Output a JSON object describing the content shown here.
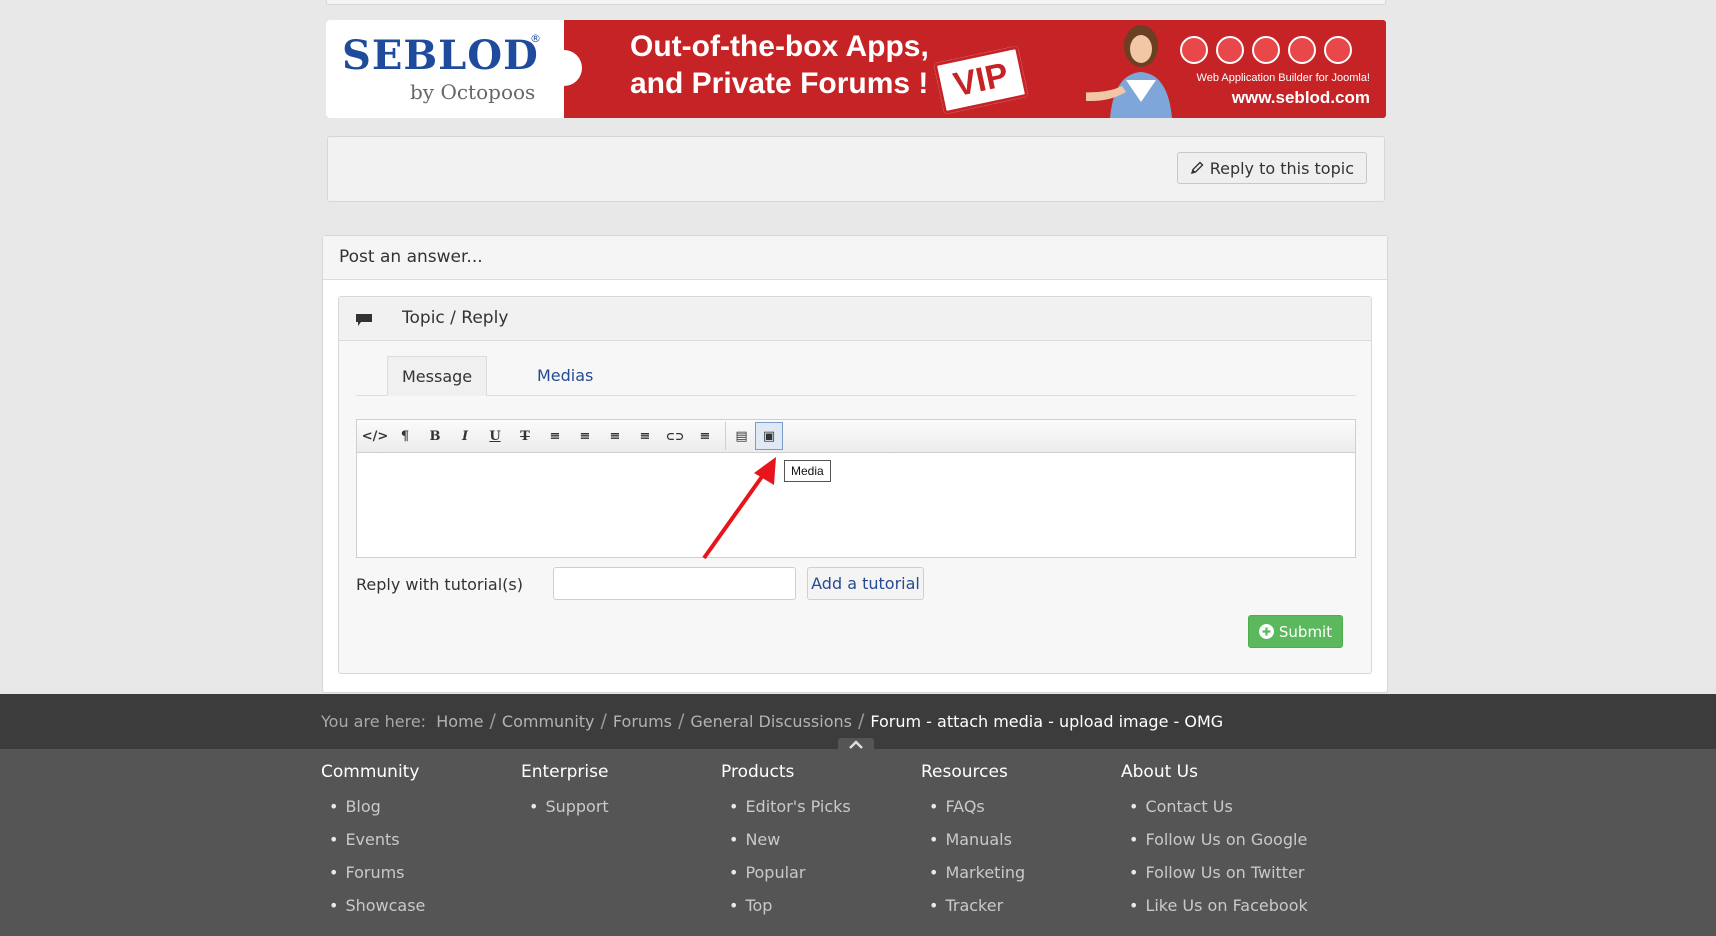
{
  "banner": {
    "logo": "SEBLOD",
    "logo_sub": "by Octopoos",
    "headline_line1": "Out-of-the-box Apps,",
    "headline_line2": "and Private Forums !",
    "badge": "VIP",
    "tagline": "Web Application Builder for Joomla!",
    "url": "www.seblod.com",
    "colors": {
      "red": "#c62326",
      "blue": "#1e4b9c"
    }
  },
  "reply_panel": {
    "reply_button": "Reply to this topic",
    "icon": "pencil-icon"
  },
  "answer": {
    "heading": "Post an answer...",
    "section_title": "Topic / Reply",
    "section_icon": "chat-bubble-icon",
    "tabs": [
      {
        "label": "Message",
        "active": true
      },
      {
        "label": "Medias",
        "active": false
      }
    ],
    "toolbar": [
      {
        "name": "code-icon",
        "glyph": "</>"
      },
      {
        "name": "paragraph-icon",
        "glyph": "¶"
      },
      {
        "name": "bold-icon",
        "glyph": "B"
      },
      {
        "name": "italic-icon",
        "glyph": "I"
      },
      {
        "name": "underline-icon",
        "glyph": "U"
      },
      {
        "name": "strikethrough-icon",
        "glyph": "T"
      },
      {
        "name": "bulleted-list-icon",
        "glyph": "≡"
      },
      {
        "name": "numbered-list-icon",
        "glyph": "≡"
      },
      {
        "name": "outdent-icon",
        "glyph": "≡"
      },
      {
        "name": "indent-icon",
        "glyph": "≡"
      },
      {
        "name": "link-icon",
        "glyph": "⊂⊃"
      },
      {
        "name": "align-icon",
        "glyph": "≡"
      },
      {
        "name": "page-break-icon",
        "glyph": "▤"
      },
      {
        "name": "media-icon",
        "glyph": "▣",
        "active": true
      }
    ],
    "tooltip": "Media",
    "tutorial_label": "Reply with tutorial(s)",
    "tutorial_input_value": "",
    "add_tutorial": "Add a tutorial",
    "submit": "Submit"
  },
  "breadcrumb": {
    "prefix": "You are here:",
    "items": [
      "Home",
      "Community",
      "Forums",
      "General Discussions"
    ],
    "current": "Forum - attach media - upload image - OMG"
  },
  "footer": {
    "columns": [
      {
        "title": "Community",
        "links": [
          "Blog",
          "Events",
          "Forums",
          "Showcase"
        ]
      },
      {
        "title": "Enterprise",
        "links": [
          "Support"
        ]
      },
      {
        "title": "Products",
        "links": [
          "Editor's Picks",
          "New",
          "Popular",
          "Top"
        ]
      },
      {
        "title": "Resources",
        "links": [
          "FAQs",
          "Manuals",
          "Marketing",
          "Tracker"
        ]
      },
      {
        "title": "About Us",
        "links": [
          "Contact Us",
          "Follow Us on Google",
          "Follow Us on Twitter",
          "Like Us on Facebook"
        ]
      }
    ]
  }
}
